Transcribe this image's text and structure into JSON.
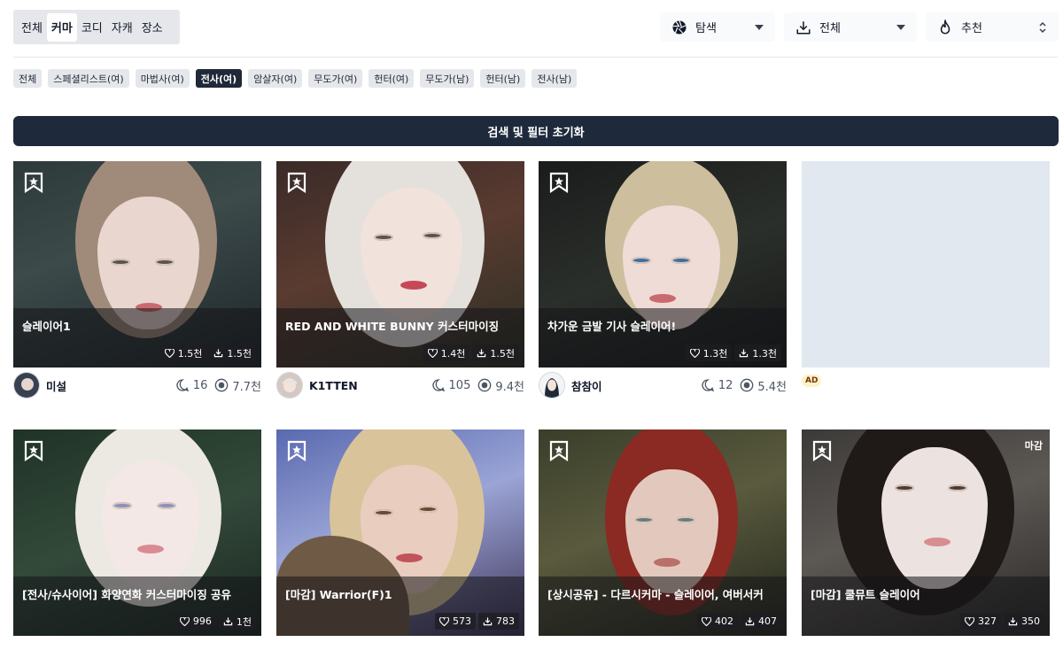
{
  "tabs": [
    {
      "label": "전체",
      "active": false
    },
    {
      "label": "커마",
      "active": true
    },
    {
      "label": "코디",
      "active": false
    },
    {
      "label": "자캐",
      "active": false
    },
    {
      "label": "장소",
      "active": false
    }
  ],
  "filters": {
    "explore": {
      "label": "탐색",
      "icon": "aperture-icon"
    },
    "download": {
      "label": "전체",
      "icon": "download-icon"
    },
    "sort": {
      "label": "추천",
      "icon": "flame-icon"
    }
  },
  "chips": [
    {
      "label": "전체",
      "active": false
    },
    {
      "label": "스페셜리스트(여)",
      "active": false
    },
    {
      "label": "마법사(여)",
      "active": false
    },
    {
      "label": "전사(여)",
      "active": true
    },
    {
      "label": "암살자(여)",
      "active": false
    },
    {
      "label": "무도가(여)",
      "active": false
    },
    {
      "label": "헌터(여)",
      "active": false
    },
    {
      "label": "무도가(남)",
      "active": false
    },
    {
      "label": "헌터(남)",
      "active": false
    },
    {
      "label": "전사(남)",
      "active": false
    }
  ],
  "reset_label": "검색 및 필터 초기화",
  "ad_label": "AD",
  "cards": [
    {
      "title": "슬레이어1",
      "likes": "1.5천",
      "downloads": "1.5천",
      "author": "미설",
      "comments": "16",
      "views": "7.7천"
    },
    {
      "title": "RED AND WHITE BUNNY 커스터마이징",
      "likes": "1.4천",
      "downloads": "1.5천",
      "author": "K1TTEN",
      "comments": "105",
      "views": "9.4천"
    },
    {
      "title": "차가운 금발 기사 슬레이어!",
      "likes": "1.3천",
      "downloads": "1.3천",
      "author": "참참이",
      "comments": "12",
      "views": "5.4천"
    },
    {
      "title": "[전사/슈사이어] 화양연화 커스터마이징 공유",
      "likes": "996",
      "downloads": "1천",
      "author": "",
      "comments": "",
      "views": ""
    },
    {
      "title": "[마감] Warrior(F)1",
      "likes": "573",
      "downloads": "783",
      "author": "",
      "comments": "",
      "views": ""
    },
    {
      "title": "[상시공유] - 다르시커마 - 슬레이어, 여버서커",
      "likes": "402",
      "downloads": "407",
      "author": "",
      "comments": "",
      "views": ""
    },
    {
      "title": "[마감] 쿨뮤트 슬레이어",
      "likes": "327",
      "downloads": "350",
      "author": "",
      "comments": "",
      "views": "",
      "badge": "마감"
    }
  ],
  "colors": {
    "accent": "#1e293b",
    "chip_active": "#1f2937",
    "chip_bg": "#e5e7eb"
  }
}
